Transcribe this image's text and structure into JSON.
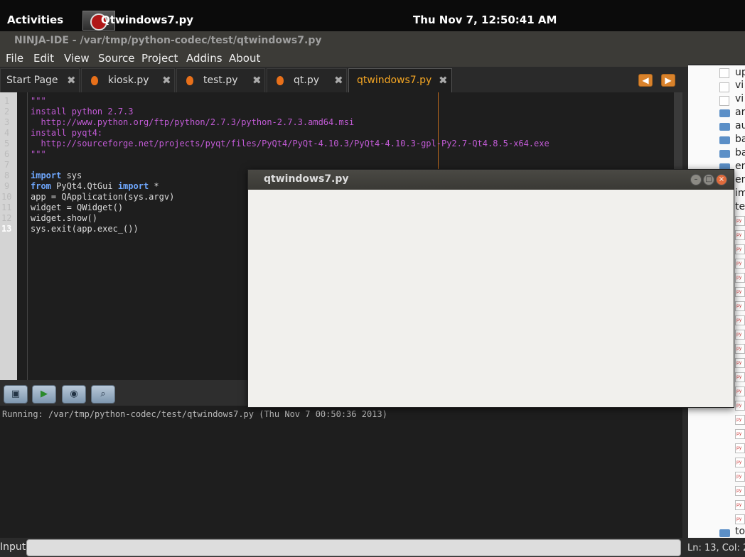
{
  "topbar": {
    "activities": "Activities",
    "app_title": "Qtwindows7.py",
    "clock": "Thu Nov  7, 12:50:41 AM"
  },
  "window_title": "NINJA-IDE - /var/tmp/python-codec/test/qtwindows7.py",
  "menu": [
    "File",
    "Edit",
    "View",
    "Source",
    "Project",
    "Addins",
    "About"
  ],
  "tabs": [
    {
      "label": "Start Page"
    },
    {
      "label": "kiosk.py"
    },
    {
      "label": "test.py"
    },
    {
      "label": "qt.py"
    },
    {
      "label": "qtwindows7.py"
    }
  ],
  "tab_close_glyph": "✖",
  "nav": {
    "back": "◀",
    "forward": "▶"
  },
  "line_numbers": [
    "1",
    "2",
    "3",
    "4",
    "5",
    "6",
    "7",
    "8",
    "9",
    "10",
    "11",
    "12",
    "13"
  ],
  "code_lines": [
    "\"\"\"",
    "install python 2.7.3",
    "  http://www.python.org/ftp/python/2.7.3/python-2.7.3.amd64.msi",
    "install pyqt4:",
    "  http://sourceforge.net/projects/pyqt/files/PyQt4/PyQt-4.10.3/PyQt4-4.10.3-gpl-Py2.7-Qt4.8.5-x64.exe",
    "\"\"\"",
    "",
    "import sys",
    "from PyQt4.QtGui import *",
    "app = QApplication(sys.argv)",
    "widget = QWidget()",
    "widget.show()",
    "sys.exit(app.exec_())"
  ],
  "toolbar_icons": [
    "console-icon",
    "run-icon",
    "stop-icon",
    "search-icon"
  ],
  "output": {
    "running": "Running: /var/tmp/python-codec/test/qtwindows7.py (Thu Nov  7 00:50:36 2013)"
  },
  "tree": {
    "items": [
      {
        "text": "up",
        "kind": "file"
      },
      {
        "text": "vi",
        "kind": "pyfile"
      },
      {
        "text": "vi",
        "kind": "pyfile"
      },
      {
        "text": "ar",
        "kind": "folder"
      },
      {
        "text": "au",
        "kind": "folder"
      },
      {
        "text": "ba",
        "kind": "folder"
      },
      {
        "text": "ba",
        "kind": "folder"
      },
      {
        "text": "en",
        "kind": "folder"
      },
      {
        "text": "en",
        "kind": "folder"
      },
      {
        "text": "im",
        "kind": "folder"
      },
      {
        "text": "te",
        "kind": "folder"
      },
      {
        "text": "to",
        "kind": "folder"
      }
    ]
  },
  "input": {
    "label": "Input:",
    "value": "",
    "position": "Ln: 13, Col: 2"
  },
  "qt_window": {
    "title": "qtwindows7.py",
    "min": "–",
    "max": "□",
    "close": "×"
  },
  "colors": {
    "keyword": "#6fa8ff",
    "string": "#c25bd6",
    "tab_active": "#f5a623",
    "accent": "#e8701a"
  }
}
